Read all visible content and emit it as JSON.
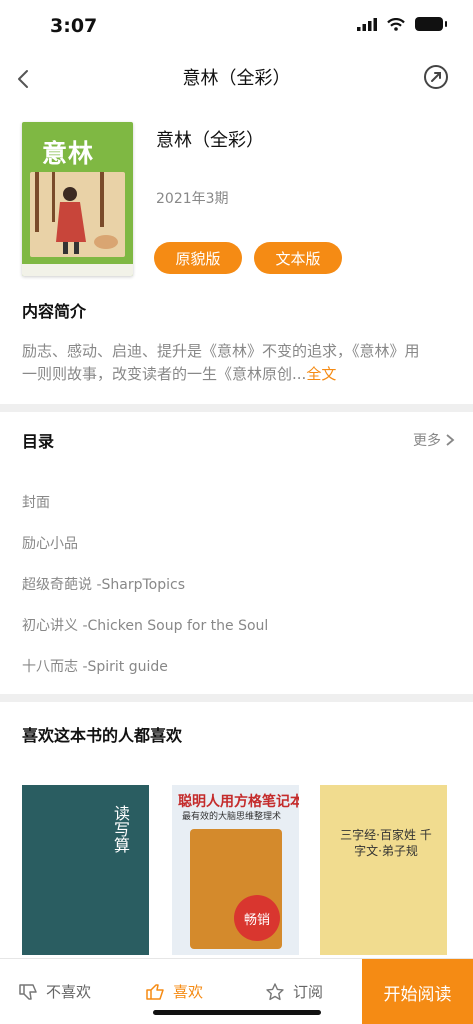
{
  "status": {
    "time": "3:07"
  },
  "nav": {
    "title": "意林（全彩）"
  },
  "book": {
    "cover_title": "意林",
    "title": "意林（全彩）",
    "issue": "2021年3期",
    "btn_original": "原貌版",
    "btn_text": "文本版"
  },
  "intro": {
    "heading": "内容简介",
    "text": "励志、感动、启迪、提升是《意林》不变的追求，《意林》用一则则故事，改变读者的一生《意林原创...",
    "full_link": "全文"
  },
  "toc": {
    "heading": "目录",
    "more": "更多",
    "items": [
      "封面",
      "励心小品",
      "超级奇葩说 -SharpTopics",
      "初心讲义 -Chicken Soup for the Soul",
      "十八而志 -Spirit guide"
    ]
  },
  "recommend": {
    "heading": "喜欢这本书的人都喜欢",
    "book1_text": "读写算",
    "book2_title": "聪明人用方格笔记本",
    "book2_sub": "最有效的大脑思维整理术",
    "book2_stamp": "畅销",
    "book3_text": "三字经·百家姓 千字文·弟子规"
  },
  "bottom": {
    "dislike": "不喜欢",
    "like": "喜欢",
    "subscribe": "订阅",
    "start": "开始阅读"
  },
  "colors": {
    "accent": "#f58b14"
  }
}
